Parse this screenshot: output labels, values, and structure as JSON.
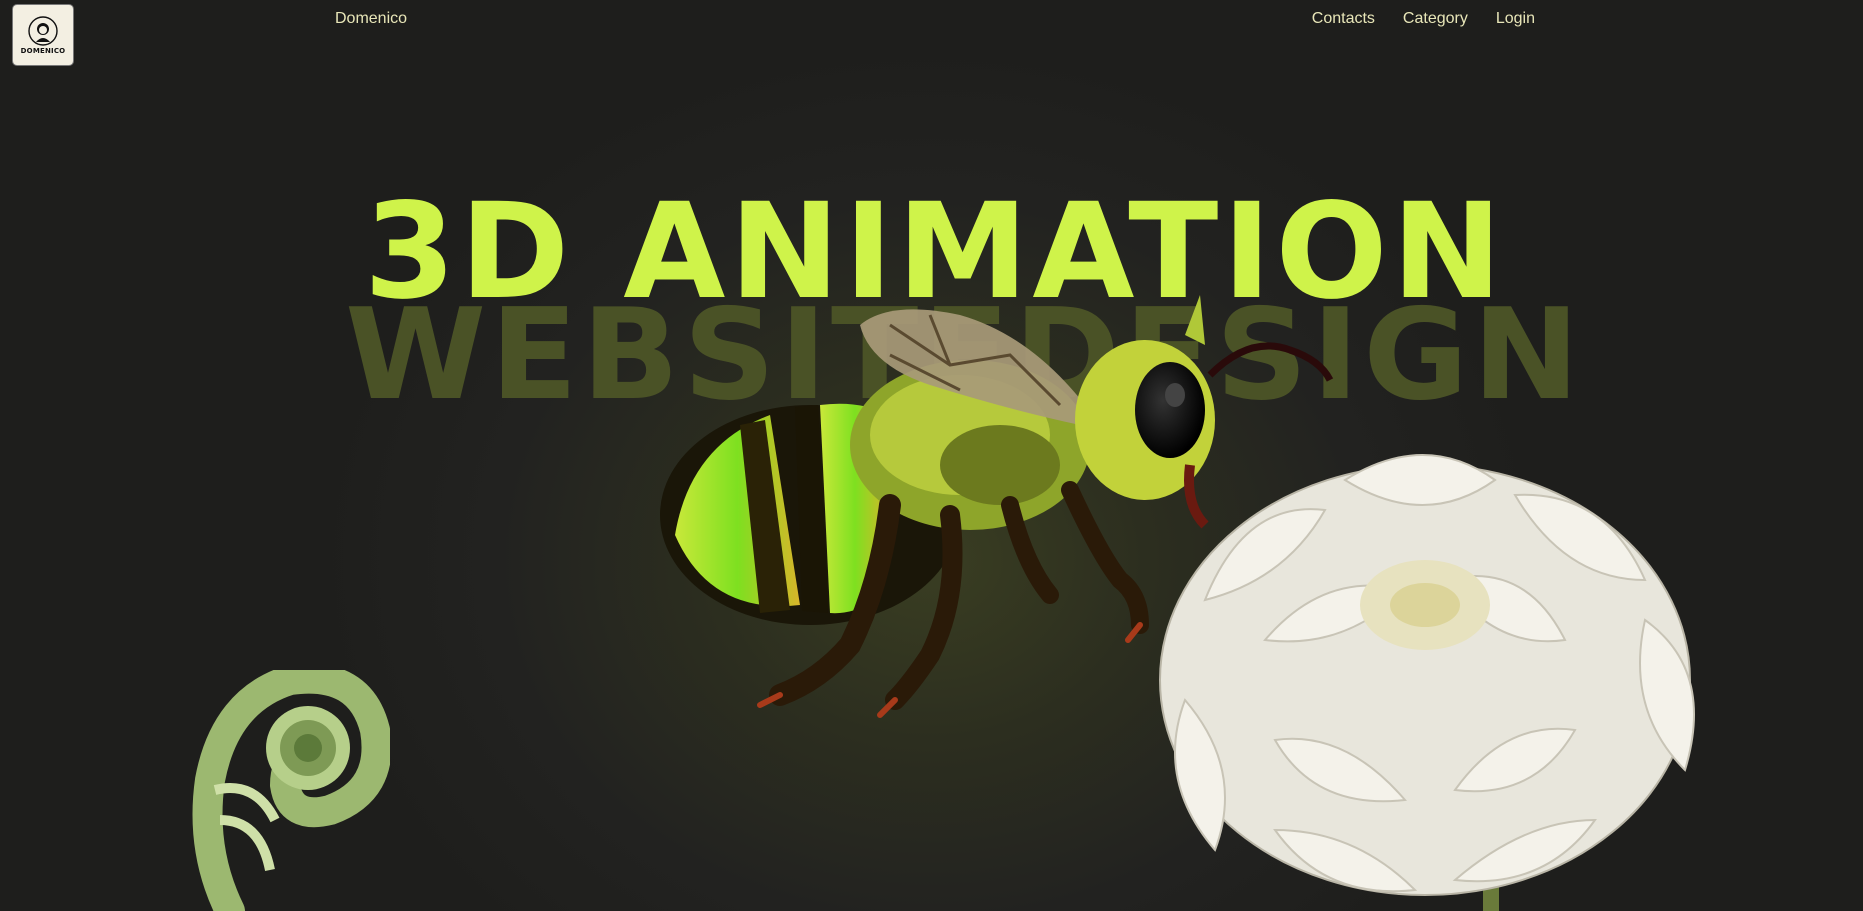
{
  "logo": {
    "text": "DOMENICO"
  },
  "header": {
    "brand": "Domenico"
  },
  "nav": {
    "items": [
      "Contacts",
      "Category",
      "Login"
    ]
  },
  "hero": {
    "title": "3D ANIMATION",
    "subtitle_back": "WEBSITEDESIGN"
  },
  "colors": {
    "accent": "#cff34a",
    "accent_dim": "#4a5226",
    "nav_text": "#e8e6b8",
    "background": "#1e1e1c"
  },
  "icons": [
    "logo-portrait",
    "bee-illustration",
    "chrysanthemum-illustration",
    "fern-illustration"
  ]
}
